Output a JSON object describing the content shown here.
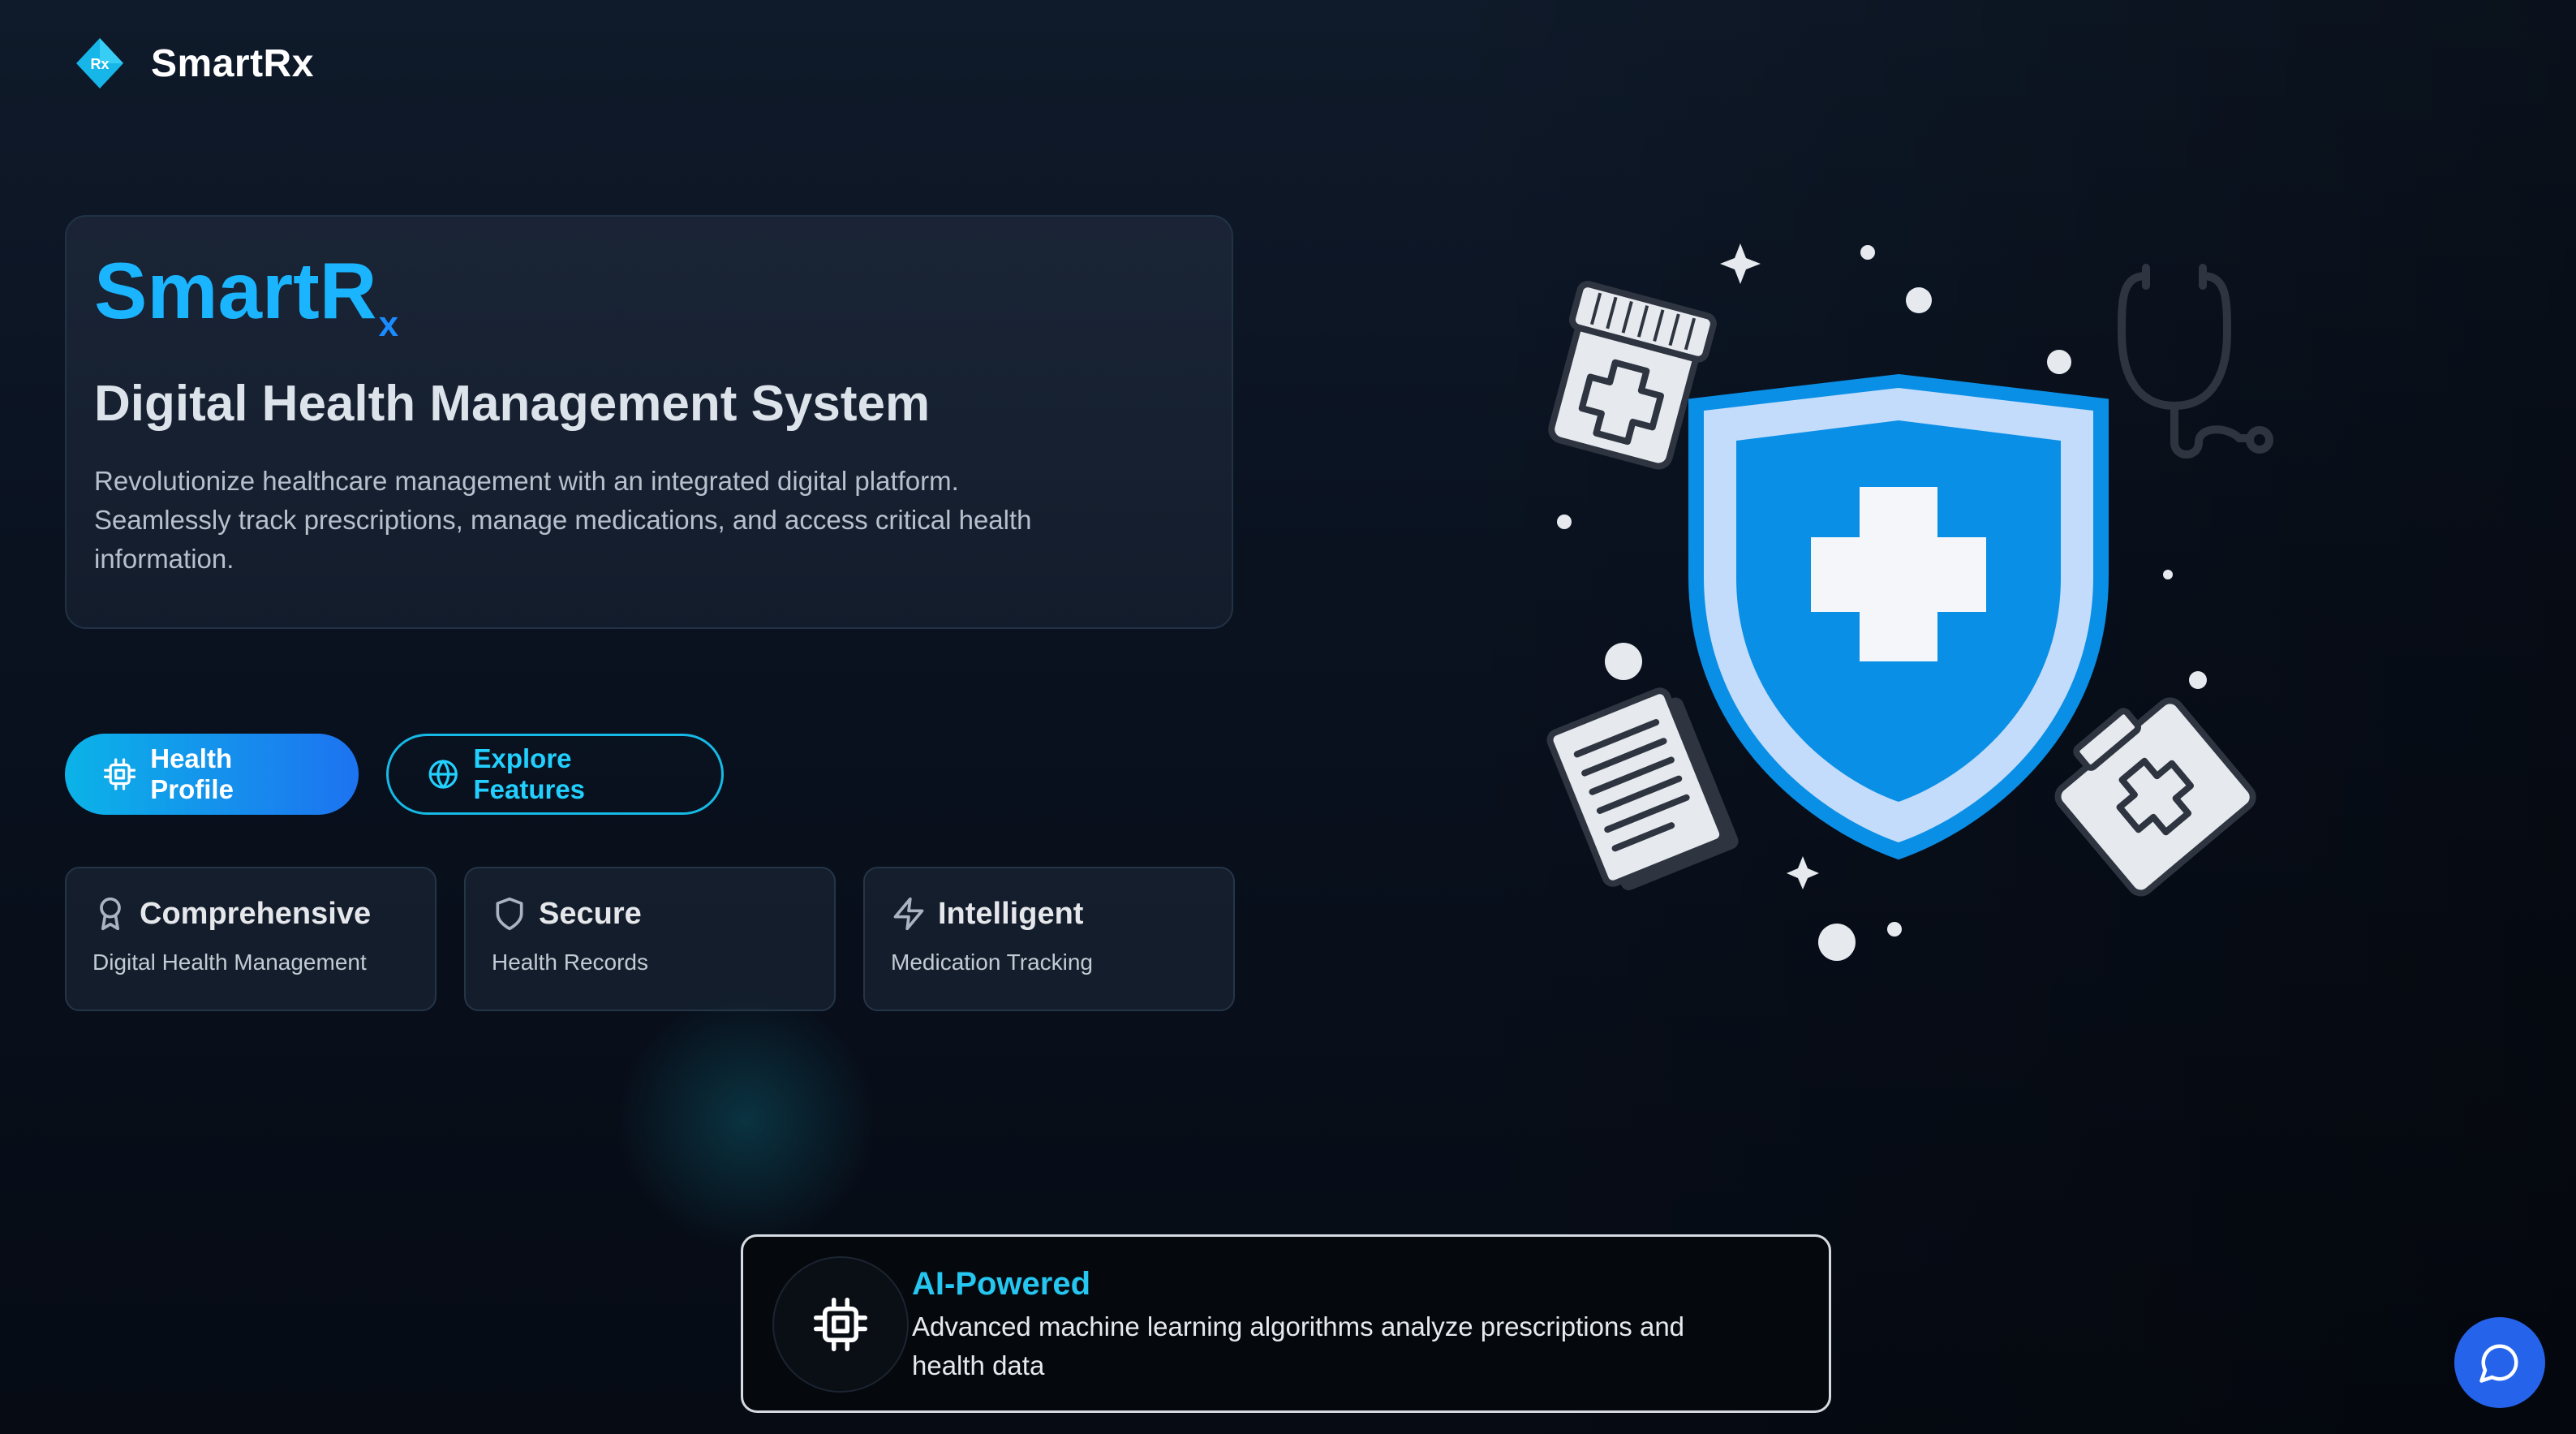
{
  "header": {
    "brand": "SmartRx",
    "logo_icon": "rx-diamond-logo-icon",
    "logo_text": "Rx"
  },
  "hero": {
    "title_main": "SmartR",
    "title_sub": "x",
    "subtitle": "Digital Health Management System",
    "description": "Revolutionize healthcare management with an integrated digital platform. Seamlessly track prescriptions, manage medications, and access critical health information."
  },
  "buttons": {
    "primary": {
      "label": "Health Profile",
      "icon": "chip-icon"
    },
    "secondary": {
      "label": "Explore Features",
      "icon": "globe-icon"
    }
  },
  "features": [
    {
      "title": "Comprehensive",
      "subtitle": "Digital Health Management",
      "icon": "award-icon"
    },
    {
      "title": "Secure",
      "subtitle": "Health Records",
      "icon": "shield-icon"
    },
    {
      "title": "Intelligent",
      "subtitle": "Medication Tracking",
      "icon": "zap-icon"
    }
  ],
  "ai_card": {
    "title": "AI-Powered",
    "description": "Advanced machine learning algorithms analyze prescriptions and health data",
    "icon": "cpu-icon"
  },
  "chat": {
    "icon": "message-circle-icon"
  },
  "colors": {
    "accent": "#1ab4ff",
    "primary_gradient_start": "#0bb3e8",
    "primary_gradient_end": "#1d73f0",
    "shield_blue": "#0a8fe6",
    "chat_button": "#2563eb"
  }
}
